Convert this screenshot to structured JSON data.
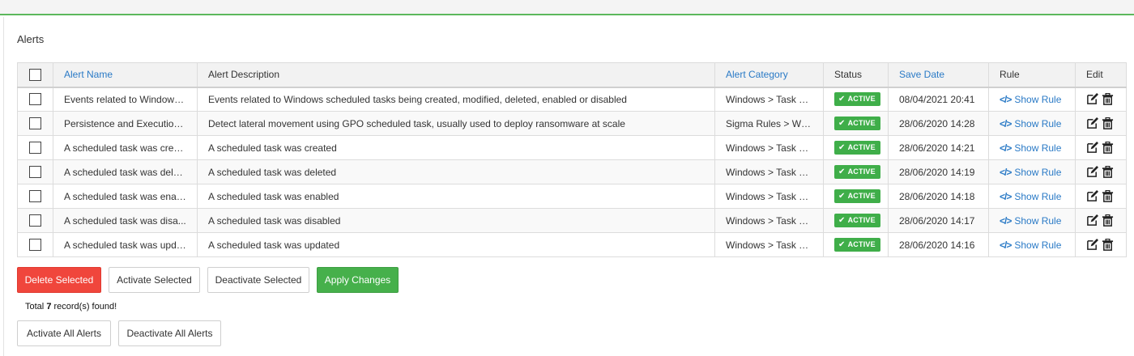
{
  "page": {
    "title": "Alerts"
  },
  "table": {
    "headers": {
      "alert_name": "Alert Name",
      "alert_description": "Alert Description",
      "alert_category": "Alert Category",
      "status": "Status",
      "save_date": "Save Date",
      "rule": "Rule",
      "edit": "Edit"
    },
    "rows": [
      {
        "name": "Events related to Windows ...",
        "description": "Events related to Windows scheduled tasks being created, modified, deleted, enabled or disabled",
        "category": "Windows > Task S...",
        "status": "ACTIVE",
        "date": "08/04/2021 20:41",
        "rule": "Show Rule"
      },
      {
        "name": "Persistence and Execution ...",
        "description": "Detect lateral movement using GPO scheduled task, usually used to deploy ransomware at scale",
        "category": "Sigma Rules > Win...",
        "status": "ACTIVE",
        "date": "28/06/2020 14:28",
        "rule": "Show Rule"
      },
      {
        "name": "A scheduled task was crea...",
        "description": "A scheduled task was created",
        "category": "Windows > Task S...",
        "status": "ACTIVE",
        "date": "28/06/2020 14:21",
        "rule": "Show Rule"
      },
      {
        "name": "A scheduled task was delet...",
        "description": "A scheduled task was deleted",
        "category": "Windows > Task S...",
        "status": "ACTIVE",
        "date": "28/06/2020 14:19",
        "rule": "Show Rule"
      },
      {
        "name": "A scheduled task was enab...",
        "description": "A scheduled task was enabled",
        "category": "Windows > Task S...",
        "status": "ACTIVE",
        "date": "28/06/2020 14:18",
        "rule": "Show Rule"
      },
      {
        "name": "A scheduled task was disa...",
        "description": "A scheduled task was disabled",
        "category": "Windows > Task S...",
        "status": "ACTIVE",
        "date": "28/06/2020 14:17",
        "rule": "Show Rule"
      },
      {
        "name": "A scheduled task was upda...",
        "description": "A scheduled task was updated",
        "category": "Windows > Task S...",
        "status": "ACTIVE",
        "date": "28/06/2020 14:16",
        "rule": "Show Rule"
      }
    ]
  },
  "actions": {
    "delete_selected": "Delete Selected",
    "activate_selected": "Activate Selected",
    "deactivate_selected": "Deactivate Selected",
    "apply_changes": "Apply Changes",
    "activate_all": "Activate All Alerts",
    "deactivate_all": "Deactivate All Alerts"
  },
  "summary": {
    "prefix": "Total",
    "count": "7",
    "suffix": "record(s) found!"
  },
  "icons": {
    "status_check": "check-icon",
    "rule": "code-icon",
    "edit": "edit-icon",
    "delete": "trash-icon"
  },
  "colors": {
    "accent_green": "#5cb85c",
    "active_badge": "#3fae49",
    "link_blue": "#2a7ac6",
    "delete_red": "#f0463c",
    "apply_green": "#46b04b"
  }
}
